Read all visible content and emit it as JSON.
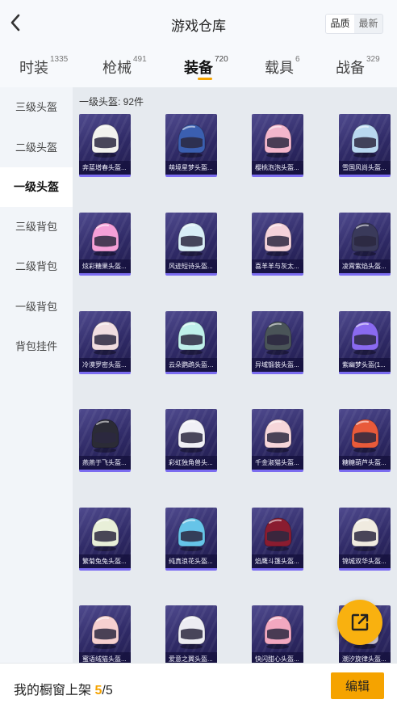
{
  "header": {
    "title": "游戏仓库",
    "back_icon": "chevron-left-icon"
  },
  "sort": {
    "options": [
      "品质",
      "最新"
    ],
    "active": "品质"
  },
  "tabs": [
    {
      "label": "时装",
      "count": "1335"
    },
    {
      "label": "枪械",
      "count": "491"
    },
    {
      "label": "装备",
      "count": "720",
      "active": true
    },
    {
      "label": "载具",
      "count": "6"
    },
    {
      "label": "战备",
      "count": "329"
    }
  ],
  "sidebar": {
    "items": [
      {
        "label": "三级头盔"
      },
      {
        "label": "二级头盔"
      },
      {
        "label": "一级头盔",
        "active": true
      },
      {
        "label": "三级背包"
      },
      {
        "label": "二级背包"
      },
      {
        "label": "一级背包"
      },
      {
        "label": "背包挂件"
      }
    ]
  },
  "section": {
    "label": "一级头盔: 92件"
  },
  "items": [
    {
      "name": "奔蓝增春头盔...",
      "color": "#f2f2ee"
    },
    {
      "name": "萌境星梦头盔...",
      "color": "#3b5fb0"
    },
    {
      "name": "樱桃泡泡头盔...",
      "color": "#f3b6cc"
    },
    {
      "name": "雪国风尚头盔...",
      "color": "#b9d8f0"
    },
    {
      "name": "炫彩糖果头盔...",
      "color": "#f5a0d8"
    },
    {
      "name": "风迹短诗头盔...",
      "color": "#d8eef6"
    },
    {
      "name": "喜羊羊与灰太...",
      "color": "#f4d2da"
    },
    {
      "name": "凌霄紫焰头盔...",
      "color": "#3a3a5a"
    },
    {
      "name": "冷漠罗密头盔...",
      "color": "#f0dde0"
    },
    {
      "name": "云朵鹦鹉头盔(1...",
      "color": "#bff0ea"
    },
    {
      "name": "异域锻装头盔...",
      "color": "#4a5458"
    },
    {
      "name": "紫幽梦头盔(1...",
      "color": "#8a6af0"
    },
    {
      "name": "燕燕于飞头盔...",
      "color": "#2b2b36"
    },
    {
      "name": "彩虹独角兽头...",
      "color": "#f0f0f6"
    },
    {
      "name": "千金淑猫头盔...",
      "color": "#f6d6da"
    },
    {
      "name": "糖糖葫芦头盔...",
      "color": "#e85a3a"
    },
    {
      "name": "繁菊兔兔头盔...",
      "color": "#e8efd8"
    },
    {
      "name": "纯真浪花头盔...",
      "color": "#66c4e8"
    },
    {
      "name": "焰鹰斗篷头盔...",
      "color": "#8a1c30"
    },
    {
      "name": "锦城双华头盔...",
      "color": "#f0ebe0"
    },
    {
      "name": "蜜语绒猫头盔...",
      "color": "#f6d0d0"
    },
    {
      "name": "爱意之翼头盔...",
      "color": "#ececf2"
    },
    {
      "name": "快闪甜心头盔...",
      "color": "#f2a8c0"
    },
    {
      "name": "潮汐旋律头盔...",
      "color": "#ddd6e6"
    }
  ],
  "fab": {
    "icon": "external-link-icon"
  },
  "footer": {
    "text": "我的橱窗上架 ",
    "current": "5",
    "separator": "/",
    "total": "5",
    "edit_label": "编辑"
  }
}
